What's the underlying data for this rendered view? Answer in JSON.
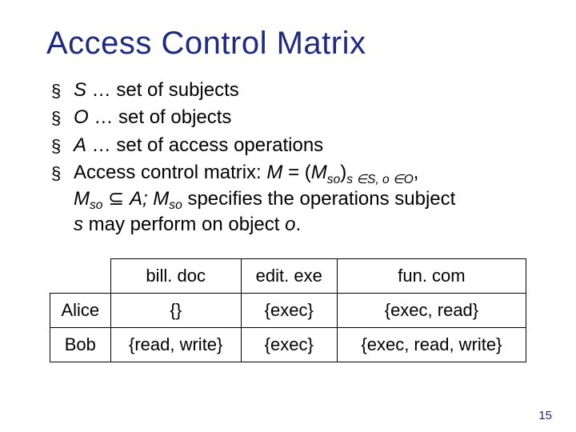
{
  "title": "Access Control Matrix",
  "bullets": {
    "b1_pre": "S",
    "b1_post": " … set of subjects",
    "b2_pre": "O",
    "b2_post": " … set of objects",
    "b3_pre": "A",
    "b3_post": " … set of access operations"
  },
  "b4": {
    "t0": "Access control matrix: ",
    "M": "M",
    "eq": " = (",
    "Mso1": "M",
    "sub1": "so",
    "paren": ")",
    "tail_sub": "s ∈S, o ∈O",
    "comma": ",",
    "Mso2": "M",
    "sub2": "so",
    "subset": " ⊆ ",
    "A": "A;",
    "sep": "  ",
    "Mso3": "M",
    "sub3": "so",
    "spec": " specifies the operations subject ",
    "s": "s",
    "mid": " may perform on object ",
    "o": "o",
    "dot": "."
  },
  "table": {
    "headers": [
      "bill. doc",
      "edit. exe",
      "fun. com"
    ],
    "rows": [
      {
        "name": "Alice",
        "cells": [
          "{}",
          "{exec}",
          "{exec, read}"
        ]
      },
      {
        "name": "Bob",
        "cells": [
          "{read, write}",
          "{exec}",
          "{exec, read, write}"
        ]
      }
    ]
  },
  "page": "15"
}
